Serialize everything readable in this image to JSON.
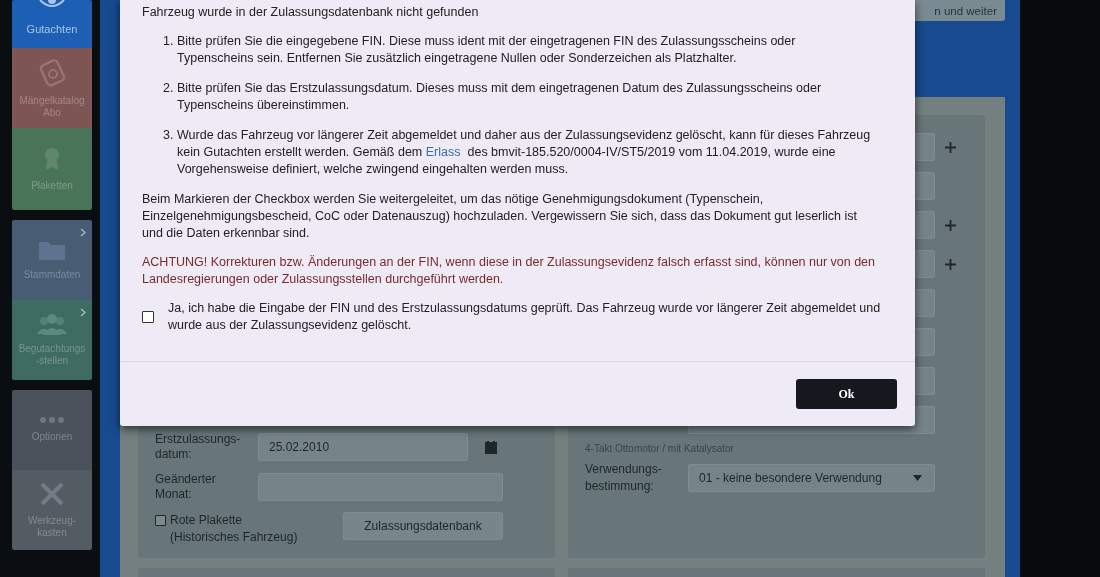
{
  "sidebar": {
    "groups": [
      {
        "items": [
          {
            "label": "Gutachten",
            "selected": true,
            "submenu": false,
            "color": "#1c5fb4"
          },
          {
            "label": "Mängelkatalog Abo",
            "selected": false,
            "submenu": false,
            "color": "#7d5654"
          },
          {
            "label": "Plaketten",
            "selected": false,
            "submenu": false,
            "color": "#4a7458"
          }
        ]
      },
      {
        "items": [
          {
            "label": "Stammdaten",
            "selected": false,
            "submenu": true,
            "color": "#485c74"
          },
          {
            "label": "Begutachtungs-stellen",
            "selected": false,
            "submenu": true,
            "color": "#3e6b62"
          }
        ]
      },
      {
        "items": [
          {
            "label": "Optionen",
            "selected": false,
            "submenu": false,
            "color": "#4b525c"
          },
          {
            "label": "Werkzeug-kasten",
            "selected": false,
            "submenu": false,
            "color": "#535b63"
          }
        ]
      }
    ]
  },
  "top_button": {
    "label": "n und weiter"
  },
  "form": {
    "left": {
      "fields": [
        {
          "label": "Erstzulassungs-datum:",
          "value": "25.02.2010",
          "kind": "date"
        },
        {
          "label": "Geänderter Monat:",
          "kind": "text"
        }
      ],
      "checkbox": {
        "label": "Rote Plakette (Historisches Fahrzeug)",
        "checked": false
      },
      "button": "Zulassungsdatenbank"
    },
    "right": {
      "rows": [
        {
          "kind": "input",
          "add": true
        },
        {
          "kind": "input",
          "add": false
        },
        {
          "kind": "input",
          "add": true
        },
        {
          "kind": "input",
          "add": true
        },
        {
          "kind": "input",
          "add": false
        },
        {
          "kind": "input",
          "add": false
        },
        {
          "kind": "select",
          "add": false
        },
        {
          "kind": "select",
          "add": false,
          "hint": "4-Takt Ottomotor / mit Katalysator"
        },
        {
          "kind": "select",
          "add": false,
          "label": "Verwendungs-bestimmung:",
          "value": "01 - keine besondere Verwendung"
        }
      ]
    }
  },
  "dialog": {
    "heading": "Fahrzeug wurde in der Zulassungsdatenbank nicht gefunden",
    "steps": [
      {
        "number": "1.",
        "text": "Bitte prüfen Sie die eingegebene FIN. Diese muss ident mit der eingetragenen FIN des Zulassungsscheins oder Typenscheins sein. Entfernen Sie zusätzlich eingetragene Nullen oder Sonderzeichen als Platzhalter."
      },
      {
        "number": "2.",
        "text": "Bitte prüfen Sie das Erstzulassungsdatum. Dieses muss mit dem eingetragenen Datum des Zulassungsscheins oder Typenscheins übereinstimmen."
      },
      {
        "number": "3.",
        "text": "Wurde das Fahrzeug vor längerer Zeit abgemeldet und daher aus der Zulassungsevidenz gelöscht, kann für dieses Fahrzeug kein Gutachten erstellt werden. Gemäß dem",
        "link": "Erlass",
        "text_after": "des bmvit-185.520/0004-IV/ST5/2019 vom 11.04.2019, wurde eine Vorgehensweise definiert, welche zwingend eingehalten werden muss."
      }
    ],
    "info": "Beim Markieren der Checkbox werden Sie weitergeleitet, um das nötige Genehmigungsdokument (Typenschein, Einzelgenehmigungsbescheid, CoC oder Datenauszug) hochzuladen. Vergewissern Sie sich, dass das Dokument gut leserlich ist und die Daten erkennbar sind.",
    "warning": "ACHTUNG! Korrekturen bzw. Änderungen an der FIN, wenn diese in der Zulassungsevidenz falsch erfasst sind, können nur von den Landesregierungen oder Zulassungsstellen durchgeführt werden.",
    "confirm": {
      "label": "Ja, ich habe die Eingabe der FIN und des Erstzulassungsdatums geprüft. Das Fahrzeug wurde vor längerer Zeit abgemeldet und wurde aus der Zulassungsevidenz gelöscht.",
      "checked": false
    },
    "ok_button": "Ok"
  }
}
